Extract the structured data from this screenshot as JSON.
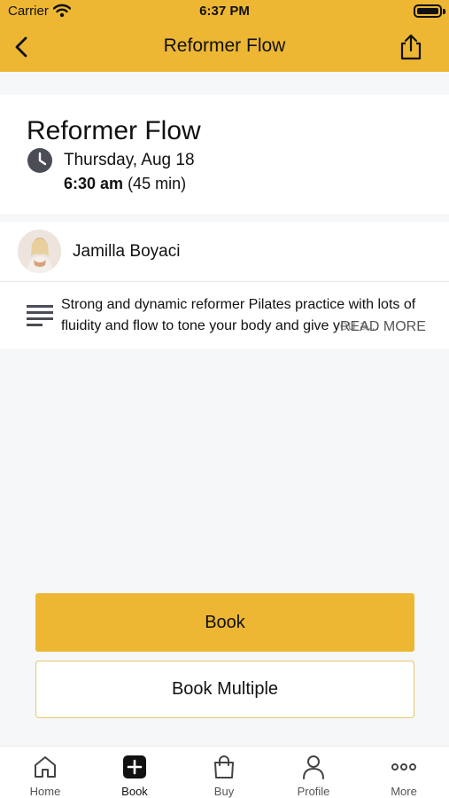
{
  "status_bar": {
    "carrier": "Carrier",
    "time": "6:37 PM"
  },
  "nav": {
    "title": "Reformer Flow",
    "back_icon": "chevron-left-icon",
    "share_icon": "share-icon"
  },
  "class_info": {
    "title": "Reformer Flow",
    "date": "Thursday, Aug 18",
    "time_start": "6:30 am",
    "duration": "(45 min)"
  },
  "instructor": {
    "name": "Jamilla Boyaci"
  },
  "description": {
    "text": "Strong and dynamic reformer Pilates practice with lots of fluidity and flow to tone your body and give you a...",
    "read_more": "READ MORE"
  },
  "actions": {
    "book": "Book",
    "book_multiple": "Book Multiple"
  },
  "tabs": [
    {
      "label": "Home",
      "icon": "home-icon"
    },
    {
      "label": "Book",
      "icon": "plus-square-icon"
    },
    {
      "label": "Buy",
      "icon": "shopping-bag-icon"
    },
    {
      "label": "Profile",
      "icon": "user-icon"
    },
    {
      "label": "More",
      "icon": "more-dots-icon"
    }
  ],
  "colors": {
    "accent": "#edb734",
    "background": "#f6f7f9"
  }
}
